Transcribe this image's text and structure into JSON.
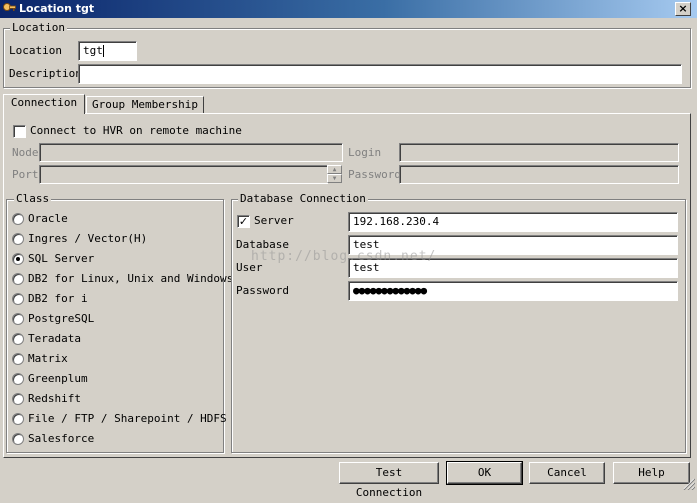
{
  "window": {
    "title": "Location tgt",
    "close_glyph": "×"
  },
  "location_group": {
    "legend": "Location",
    "location_label": "Location",
    "location_value": "tgt",
    "description_label": "Description",
    "description_value": ""
  },
  "tabs": [
    {
      "label": "Connection",
      "active": true
    },
    {
      "label": "Group Membership",
      "active": false
    }
  ],
  "connection": {
    "remote_checkbox_label": "Connect to HVR on remote machine",
    "remote_checked": false,
    "node_label": "Node",
    "port_label": "Port",
    "login_label": "Login",
    "password_label": "Password",
    "spin_up": "▲",
    "spin_down": "▼"
  },
  "class_group": {
    "legend": "Class",
    "options": [
      {
        "label": "Oracle",
        "selected": false
      },
      {
        "label": "Ingres / Vector(H)",
        "selected": false
      },
      {
        "label": "SQL Server",
        "selected": true
      },
      {
        "label": "DB2 for Linux, Unix and Windows",
        "selected": false
      },
      {
        "label": "DB2 for i",
        "selected": false
      },
      {
        "label": "PostgreSQL",
        "selected": false
      },
      {
        "label": "Teradata",
        "selected": false
      },
      {
        "label": "Matrix",
        "selected": false
      },
      {
        "label": "Greenplum",
        "selected": false
      },
      {
        "label": "Redshift",
        "selected": false
      },
      {
        "label": "File / FTP / Sharepoint / HDFS",
        "selected": false
      },
      {
        "label": "Salesforce",
        "selected": false
      }
    ]
  },
  "db_group": {
    "legend": "Database Connection",
    "server_label": "Server",
    "server_checked": true,
    "server_value": "192.168.230.4",
    "database_label": "Database",
    "database_value": "test",
    "user_label": "User",
    "user_value": "test",
    "password_label": "Password",
    "password_mask": "●●●●●●●●●●●●●"
  },
  "watermark": "http://blog.csdn.net/",
  "buttons": {
    "test_connection": "Test Connection",
    "ok": "OK",
    "cancel": "Cancel",
    "help": "Help"
  },
  "icons": {
    "title": "key-icon",
    "resize": "resize-grip-icon",
    "check": "check-icon"
  }
}
